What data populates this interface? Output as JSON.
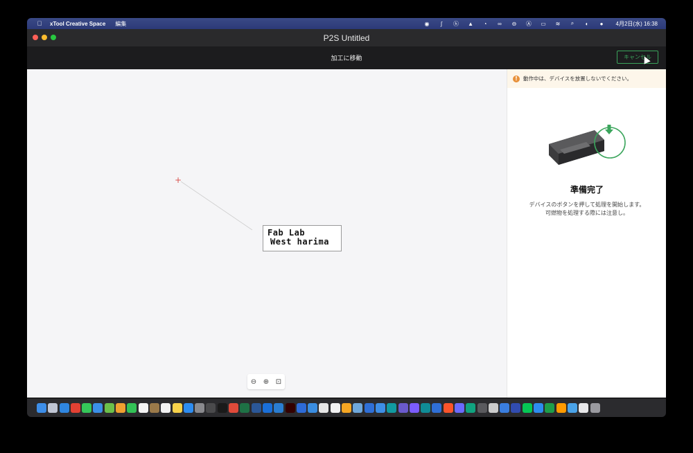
{
  "menubar": {
    "app_name": "xTool Creative Space",
    "menu_edit": "編集",
    "clock": "4月2日(水) 16:38",
    "status_icons": [
      "record-icon",
      "s-icon",
      "hk-icon",
      "drive-icon",
      "pie-icon",
      "creative-cloud-icon",
      "vpn-icon",
      "text-input-icon",
      "battery-icon",
      "wifi-icon",
      "search-icon",
      "control-center-icon",
      "siri-icon"
    ]
  },
  "window": {
    "title": "P2S Untitled"
  },
  "toolbar": {
    "title": "加工に移動",
    "cancel_label": "キャンセル"
  },
  "canvas": {
    "artwork_line1": "Fab Lab",
    "artwork_line2": "West harima",
    "origin_marker": "+"
  },
  "zoom": {
    "zoom_out": "⊖",
    "zoom_in": "⊕",
    "fit": "⊡"
  },
  "panel": {
    "warning_icon": "!",
    "warning_text": "動作中は、デバイスを放置しないでください。",
    "ready_title": "準備完了",
    "ready_desc_line1": "デバイスのボタンを押して処理を開始します。",
    "ready_desc_line2": "可燃物を処理する際には注意し。"
  },
  "colors": {
    "accent_green": "#3ba55c",
    "warning_orange": "#e8913a",
    "origin_red": "#d9534f"
  },
  "dock": {
    "apps": [
      {
        "name": "finder",
        "color": "#3d8ee8"
      },
      {
        "name": "launchpad",
        "color": "#c0c6d4"
      },
      {
        "name": "safari",
        "color": "#2f86e0"
      },
      {
        "name": "chrome",
        "color": "#e34133"
      },
      {
        "name": "messages",
        "color": "#35c759"
      },
      {
        "name": "mail",
        "color": "#3b8fe8"
      },
      {
        "name": "maps",
        "color": "#6cc04a"
      },
      {
        "name": "photos",
        "color": "#f0a030"
      },
      {
        "name": "facetime",
        "color": "#32c256"
      },
      {
        "name": "calendar",
        "color": "#f5f5f5"
      },
      {
        "name": "notes-brown",
        "color": "#9b7a4a"
      },
      {
        "name": "reminders",
        "color": "#f2f2f2"
      },
      {
        "name": "notes",
        "color": "#f7d24a"
      },
      {
        "name": "app-store",
        "color": "#2d8cf0"
      },
      {
        "name": "system-settings",
        "color": "#8a8a8e"
      },
      {
        "name": "preview",
        "color": "#4a4a4c"
      },
      {
        "name": "terminal",
        "color": "#1a1a1a"
      },
      {
        "name": "photo-editor",
        "color": "#e04a3a"
      },
      {
        "name": "excel",
        "color": "#1e7145"
      },
      {
        "name": "word",
        "color": "#2b5797"
      },
      {
        "name": "1password",
        "color": "#1a6fd8"
      },
      {
        "name": "vscode",
        "color": "#2a7dd1"
      },
      {
        "name": "illustrator",
        "color": "#330000"
      },
      {
        "name": "zoom",
        "color": "#2d6bd8"
      },
      {
        "name": "alarm",
        "color": "#3a8de0"
      },
      {
        "name": "blank-app",
        "color": "#e6e6e6"
      },
      {
        "name": "github",
        "color": "#f2f2f2"
      },
      {
        "name": "home",
        "color": "#f5a623"
      },
      {
        "name": "gallery",
        "color": "#6fa8dc"
      },
      {
        "name": "copilot",
        "color": "#2f6fd6"
      },
      {
        "name": "prompt",
        "color": "#3e8ee6"
      },
      {
        "name": "arduino",
        "color": "#119aa0"
      },
      {
        "name": "imovie",
        "color": "#6a5acd"
      },
      {
        "name": "messenger",
        "color": "#7b5cff"
      },
      {
        "name": "arduino-ide",
        "color": "#0f8c96"
      },
      {
        "name": "sourcetree",
        "color": "#2f6fd6"
      },
      {
        "name": "brave",
        "color": "#fb542b"
      },
      {
        "name": "figma",
        "color": "#6a6aff"
      },
      {
        "name": "chatgpt",
        "color": "#10a37f"
      },
      {
        "name": "github-desktop",
        "color": "#5a5a5e"
      },
      {
        "name": "script-editor",
        "color": "#cccccc"
      },
      {
        "name": "tasks",
        "color": "#3a7ee0"
      },
      {
        "name": "kicad",
        "color": "#314cb0"
      },
      {
        "name": "line",
        "color": "#06c755"
      },
      {
        "name": "xtool-creative-space",
        "color": "#2d8cf0"
      },
      {
        "name": "x-app",
        "color": "#1e9e4a"
      },
      {
        "name": "illustrator-2",
        "color": "#ff9a00"
      },
      {
        "name": "folder",
        "color": "#4aa3e8"
      },
      {
        "name": "document",
        "color": "#e8e8ea"
      },
      {
        "name": "trash",
        "color": "#9a9aa0"
      }
    ]
  }
}
